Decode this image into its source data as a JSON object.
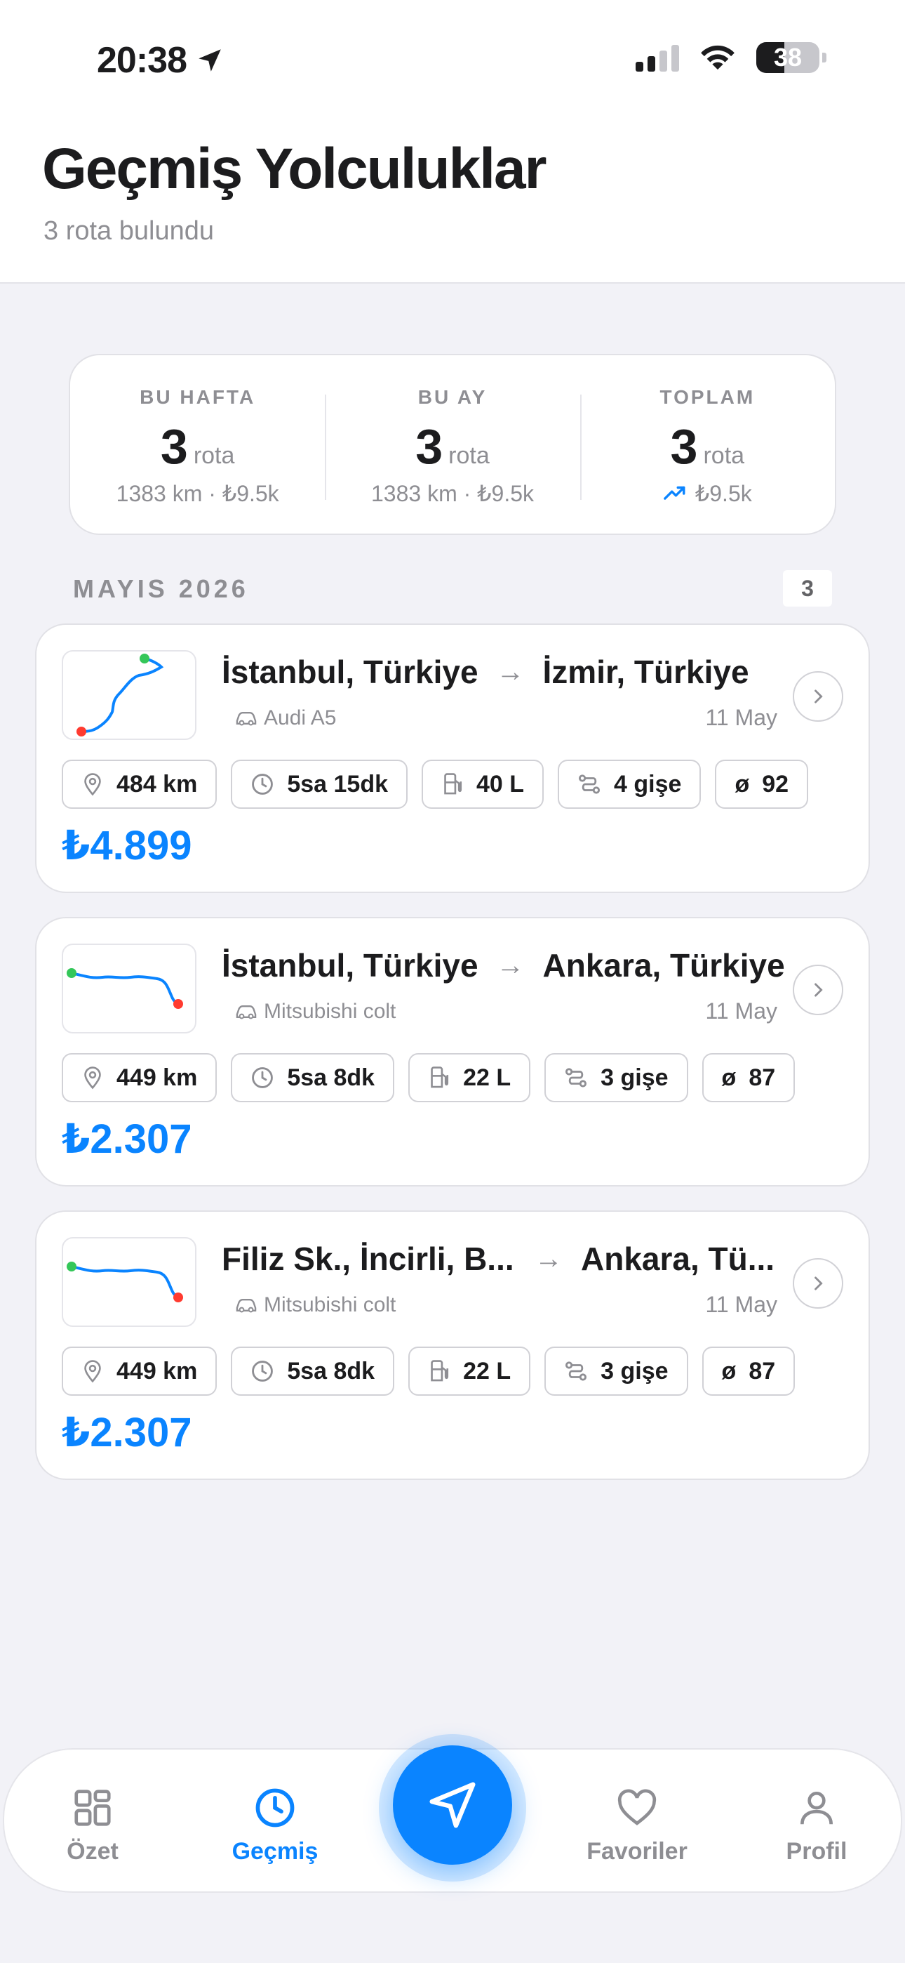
{
  "status_bar": {
    "time": "20:38",
    "battery": "38"
  },
  "header": {
    "title": "Geçmiş Yolculuklar",
    "subtitle": "3 rota bulundu"
  },
  "summary": [
    {
      "label": "BU HAFTA",
      "value": "3",
      "unit": "rota",
      "sub": "1383 km · ₺9.5k"
    },
    {
      "label": "BU AY",
      "value": "3",
      "unit": "rota",
      "sub": "1383 km · ₺9.5k"
    },
    {
      "label": "TOPLAM",
      "value": "3",
      "unit": "rota",
      "sub": "₺9.5k"
    }
  ],
  "section": {
    "title": "MAYIS 2026",
    "count": "3"
  },
  "trips": [
    {
      "from": "İstanbul, Türkiye",
      "to": "İzmir, Türkiye",
      "car": "Audi A5",
      "date": "11 May",
      "distance": "484 km",
      "duration": "5sa 15dk",
      "fuel": "40 L",
      "tolls": "4 gişe",
      "avg": "92",
      "price": "₺4.899"
    },
    {
      "from": "İstanbul, Türkiye",
      "to": "Ankara, Türkiye",
      "car": "Mitsubishi colt",
      "date": "11 May",
      "distance": "449 km",
      "duration": "5sa 8dk",
      "fuel": "22 L",
      "tolls": "3 gişe",
      "avg": "87",
      "price": "₺2.307"
    },
    {
      "from": "Filiz Sk., İncirli, B...",
      "to": "Ankara, Tü...",
      "car": "Mitsubishi colt",
      "date": "11 May",
      "distance": "449 km",
      "duration": "5sa 8dk",
      "fuel": "22 L",
      "tolls": "3 gişe",
      "avg": "87",
      "price": "₺2.307"
    }
  ],
  "tabbar": {
    "summary": "Özet",
    "history": "Geçmiş",
    "favorites": "Favoriler",
    "profile": "Profil"
  },
  "colors": {
    "accent": "#0a84ff",
    "start_marker": "#34c759",
    "end_marker": "#ff3b30"
  }
}
